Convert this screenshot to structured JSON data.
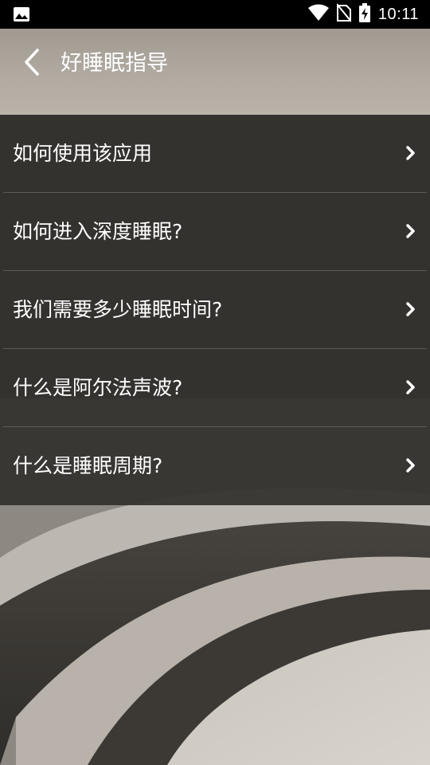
{
  "status_bar": {
    "time": "10:11",
    "icons": [
      "image-icon",
      "wifi-icon",
      "no-sim-icon",
      "battery-charging-icon"
    ]
  },
  "header": {
    "title": "好睡眠指导",
    "back_icon": "chevron-left-icon",
    "background": "#aaa49b"
  },
  "list": {
    "items": [
      {
        "label": "如何使用该应用"
      },
      {
        "label": "如何进入深度睡眠?"
      },
      {
        "label": "我们需要多少睡眠时间?"
      },
      {
        "label": "什么是阿尔法声波?"
      },
      {
        "label": "什么是睡眠周期?"
      }
    ],
    "arrow_icon": "chevron-right-icon"
  },
  "colors": {
    "list_background": "#34322f",
    "text": "#ffffff",
    "status_bar": "#000000"
  }
}
